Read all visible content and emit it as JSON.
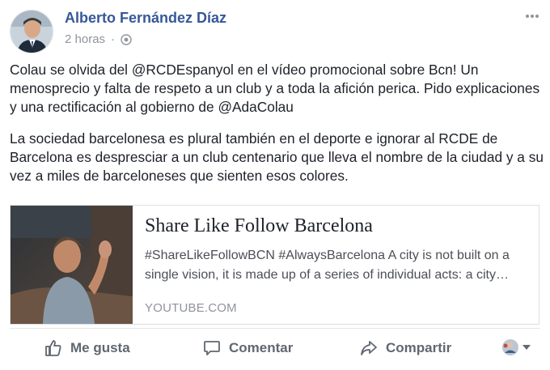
{
  "post": {
    "author": "Alberto Fernández Díaz",
    "time": "2 horas",
    "separator": "·",
    "audience_icon": "globe-icon",
    "paragraphs": [
      "Colau se olvida del @RCDEspanyol en el vídeo promocional sobre Bcn! Un menosprecio y falta de respeto a un club y a toda la afición perica. Pido explicaciones y una rectificación al gobierno de @AdaColau",
      "La sociedad barcelonesa es plural también en el deporte e ignorar al RCDE de Barcelona es despresciar a un club centenario que lleva el nombre de la ciudad y a su vez a miles de barceloneses que sienten esos colores."
    ]
  },
  "link_card": {
    "title": "Share Like Follow Barcelona",
    "description_line1": "#ShareLikeFollowBCN #AlwaysBarcelona A city is not built on a",
    "description_line2": "single vision, it is made up of a series of individual acts: a city…",
    "domain": "YOUTUBE.COM"
  },
  "actions": {
    "like": "Me gusta",
    "comment": "Comentar",
    "share": "Compartir"
  },
  "icons": {
    "like": "thumbs-up-icon",
    "comment": "speech-bubble-icon",
    "share": "share-arrow-icon",
    "menu": "more-options-icon",
    "reaction_selector": "page-avatar-dropdown-icon"
  },
  "colors": {
    "author_link": "#365899",
    "secondary_text": "#90949c",
    "action_text": "#606770",
    "body_text": "#1d2129"
  }
}
